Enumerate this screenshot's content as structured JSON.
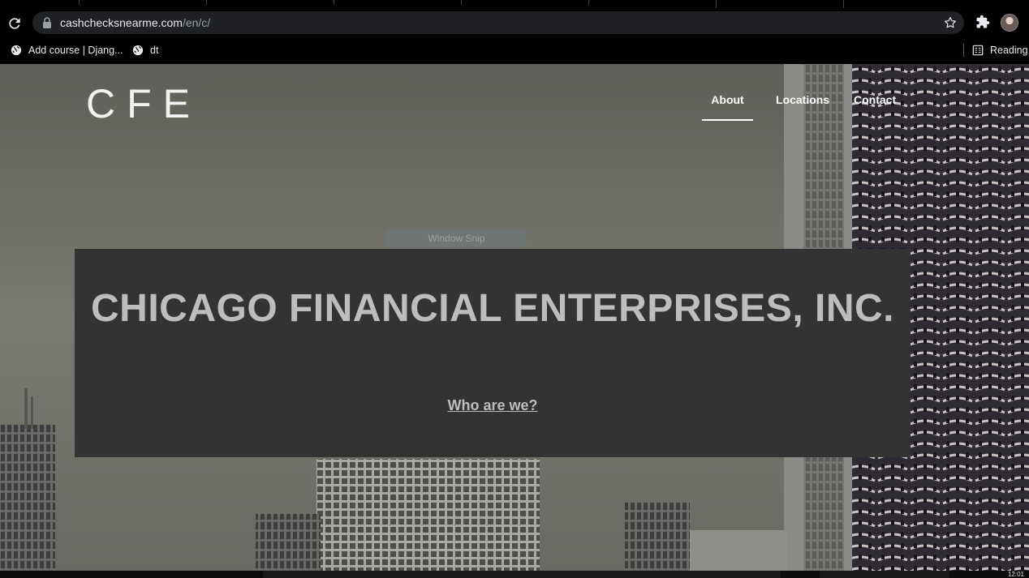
{
  "browser": {
    "url_host": "cashchecksnearme.com",
    "url_path": "/en/c/",
    "bookmarks": [
      {
        "label": "Add course | Djang..."
      },
      {
        "label": "dt"
      }
    ],
    "reading_list_label": "Reading"
  },
  "site": {
    "logo": "CFE",
    "nav": [
      {
        "label": "About",
        "active": true
      },
      {
        "label": "Locations",
        "active": false
      },
      {
        "label": "Contact",
        "active": false
      }
    ],
    "hero": {
      "title": "CHICAGO FINANCIAL ENTERPRISES, INC.",
      "link": "Who are we?"
    }
  },
  "overlay": {
    "snip_label": "Window Snip"
  },
  "taskbar": {
    "clock": "12:01"
  },
  "colors": {
    "hero_box": "#333333",
    "hero_text": "#bdbdbd",
    "chrome_bg": "#000000",
    "omnibox_bg": "#202124"
  }
}
